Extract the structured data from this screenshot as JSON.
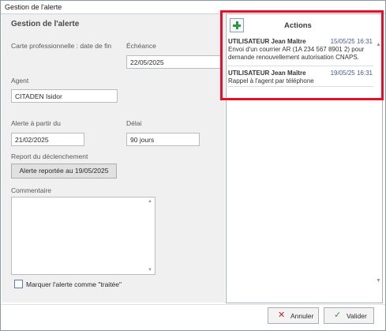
{
  "window": {
    "title": "Gestion de l'alerte"
  },
  "form": {
    "section_title": "Gestion de l'alerte",
    "carte_label": "Carte professionnelle : date de fin",
    "echeance_label": "Échéance",
    "echeance_value": "22/05/2025",
    "agent_label": "Agent",
    "agent_value": "CITADEN Isidor",
    "alerte_label": "Alerte à partir du",
    "alerte_value": "21/02/2025",
    "delai_label": "Délai",
    "delai_value": "90 jours",
    "report_label": "Report du déclenchement",
    "report_button": "Alerte reportée au 19/05/2025",
    "commentaire_label": "Commentaire",
    "commentaire_value": "",
    "checkbox_label": "Marquer l'alerte comme \"traitée\"",
    "checkbox_checked": false
  },
  "actions": {
    "title": "Actions",
    "add_icon": "plus-icon",
    "items": [
      {
        "user": "UTILISATEUR Jean Maître",
        "date": "15/05/25 16:31",
        "text": "Envoi d'un courrier AR (1A 234 567 8901 2) pour demande renouvellement autorisation CNAPS."
      },
      {
        "user": "UTILISATEUR Jean Maître",
        "date": "19/05/25 16:31",
        "text": "Rappel à l'agent par téléphone"
      }
    ]
  },
  "footer": {
    "cancel_label": "Annuler",
    "cancel_icon": "close-icon",
    "validate_label": "Valider",
    "validate_icon": "check-icon"
  },
  "colors": {
    "highlight_frame": "#e3102a",
    "add_icon": "#2b9a3a",
    "cancel_icon": "#c0262d",
    "validate_icon": "#2b9a3a"
  }
}
